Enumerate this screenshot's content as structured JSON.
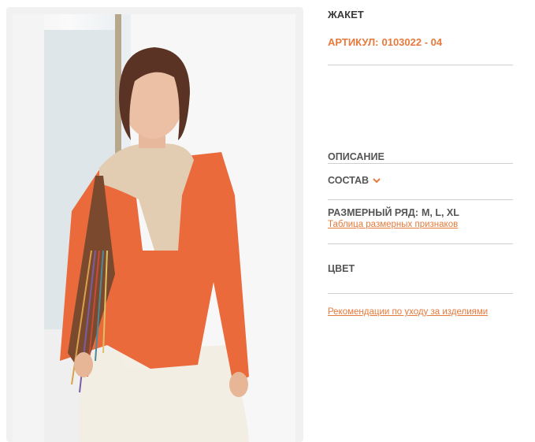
{
  "product": {
    "title": "ЖАКЕТ",
    "sku_label": "АРТИКУЛ:",
    "sku_value": "0103022 - 04"
  },
  "sections": {
    "description_label": "ОПИСАНИЕ",
    "composition_label": "СОСТАВ",
    "size_range_label": "РАЗМЕРНЫЙ РЯД:",
    "size_range_value": "M, L, XL",
    "size_table_link": "Таблица размерных признаков",
    "color_label": "ЦВЕТ",
    "care_link": "Рекомендации по уходу за изделиями"
  },
  "icons": {
    "composition_toggle": "chevron-down-icon"
  },
  "colors": {
    "accent": "#e67a3c",
    "text_dark": "#3a3a3a",
    "text_gray": "#555555",
    "divider": "#cfcfcf",
    "jacket": "#ea6a3c"
  }
}
